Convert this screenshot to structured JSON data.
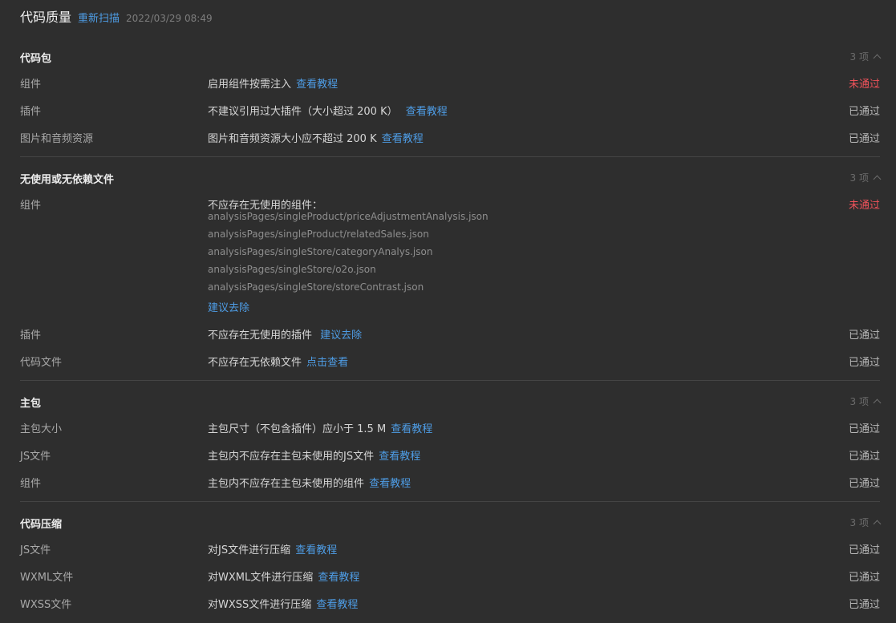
{
  "header": {
    "title": "代码质量",
    "rescan": "重新扫描",
    "timestamp": "2022/03/29 08:49"
  },
  "sections": [
    {
      "title": "代码包",
      "count": "3 项",
      "rows": [
        {
          "name": "组件",
          "desc": "启用组件按需注入",
          "link": "查看教程",
          "status": "未通过"
        },
        {
          "name": "插件",
          "desc": "不建议引用过大插件（大小超过 200 K）",
          "link": "查看教程",
          "status": "已通过"
        },
        {
          "name": "图片和音频资源",
          "desc": "图片和音频资源大小应不超过 200 K",
          "link": "查看教程",
          "status": "已通过"
        }
      ]
    },
    {
      "title": "无使用或无依赖文件",
      "count": "3 项",
      "rows": [
        {
          "name": "组件",
          "desc": "不应存在无使用的组件：",
          "paths": [
            "analysisPages/singleProduct/priceAdjustmentAnalysis.json",
            "analysisPages/singleProduct/relatedSales.json",
            "analysisPages/singleStore/categoryAnalys.json",
            "analysisPages/singleStore/o2o.json",
            "analysisPages/singleStore/storeContrast.json"
          ],
          "link": "建议去除",
          "status": "未通过"
        },
        {
          "name": "插件",
          "desc": "不应存在无使用的插件",
          "link": "建议去除",
          "status": "已通过"
        },
        {
          "name": "代码文件",
          "desc": "不应存在无依赖文件",
          "link": "点击查看",
          "status": "已通过"
        }
      ]
    },
    {
      "title": "主包",
      "count": "3 项",
      "rows": [
        {
          "name": "主包大小",
          "desc": "主包尺寸（不包含插件）应小于 1.5 M",
          "link": "查看教程",
          "status": "已通过"
        },
        {
          "name": "JS文件",
          "desc": "主包内不应存在主包未使用的JS文件",
          "link": "查看教程",
          "status": "已通过"
        },
        {
          "name": "组件",
          "desc": "主包内不应存在主包未使用的组件",
          "link": "查看教程",
          "status": "已通过"
        }
      ]
    },
    {
      "title": "代码压缩",
      "count": "3 项",
      "rows": [
        {
          "name": "JS文件",
          "desc": "对JS文件进行压缩",
          "link": "查看教程",
          "status": "已通过"
        },
        {
          "name": "WXML文件",
          "desc": "对WXML文件进行压缩",
          "link": "查看教程",
          "status": "已通过"
        },
        {
          "name": "WXSS文件",
          "desc": "对WXSS文件进行压缩",
          "link": "查看教程",
          "status": "已通过"
        }
      ]
    }
  ],
  "colors": {
    "fail": "#f0525a",
    "link": "#4e9de6",
    "background": "#2e2e2e"
  }
}
